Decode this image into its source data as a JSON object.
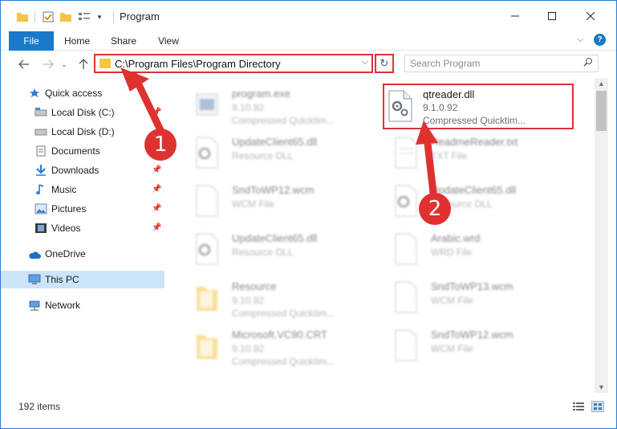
{
  "window": {
    "title": "Program"
  },
  "ribbon": {
    "tabs": [
      "File",
      "Home",
      "Share",
      "View"
    ]
  },
  "address": {
    "path": "C:\\Program Files\\Program Directory"
  },
  "search": {
    "placeholder": "Search Program"
  },
  "sidebar": {
    "items": [
      {
        "label": "Quick access",
        "icon": "star-icon",
        "pinned": false
      },
      {
        "label": "Local Disk (C:)",
        "icon": "drive-icon",
        "pinned": true
      },
      {
        "label": "Local Disk (D:)",
        "icon": "drive-icon",
        "pinned": false
      },
      {
        "label": "Documents",
        "icon": "documents-icon",
        "pinned": true
      },
      {
        "label": "Downloads",
        "icon": "download-icon",
        "pinned": true
      },
      {
        "label": "Music",
        "icon": "music-icon",
        "pinned": true
      },
      {
        "label": "Pictures",
        "icon": "pictures-icon",
        "pinned": true
      },
      {
        "label": "Videos",
        "icon": "videos-icon",
        "pinned": true
      },
      {
        "label": "OneDrive",
        "icon": "cloud-icon",
        "pinned": false
      },
      {
        "label": "This PC",
        "icon": "computer-icon",
        "pinned": false,
        "selected": true
      },
      {
        "label": "Network",
        "icon": "network-icon",
        "pinned": false
      }
    ]
  },
  "files": [
    {
      "name": "program.exe",
      "line2": "9.10.92",
      "line3": "Compressed Quicktim...",
      "icon": "exe-icon"
    },
    {
      "name": "qtreader.dll",
      "line2": "9.1.0.92",
      "line3": "Compressed Quicktim...",
      "icon": "dll-gear-icon",
      "highlighted": true
    },
    {
      "name": "UpdateClient65.dll",
      "line2": "Resource DLL",
      "line3": "",
      "icon": "dll-gear-icon"
    },
    {
      "name": "ReadmeReader.txt",
      "line2": "TXT File",
      "line3": "",
      "icon": "text-file-icon"
    },
    {
      "name": "SndToWP12.wcm",
      "line2": "WCM File",
      "line3": "",
      "icon": "blank-file-icon"
    },
    {
      "name": "UpdateClient65.dll",
      "line2": "Resource DLL",
      "line3": "",
      "icon": "dll-gear-icon"
    },
    {
      "name": "UpdateClient65.dll",
      "line2": "Resource DLL",
      "line3": "",
      "icon": "dll-gear-icon"
    },
    {
      "name": "Arabic.wrd",
      "line2": "WRD File",
      "line3": "",
      "icon": "blank-file-icon"
    },
    {
      "name": "Resource",
      "line2": "9.10.92",
      "line3": "Compressed Quicktim...",
      "icon": "folder-icon"
    },
    {
      "name": "SndToWP13.wcm",
      "line2": "WCM File",
      "line3": "",
      "icon": "blank-file-icon"
    },
    {
      "name": "Microsoft.VC90.CRT",
      "line2": "9.10.92",
      "line3": "Compressed Quicktim...",
      "icon": "folder-icon"
    },
    {
      "name": "SndToWP12.wcm",
      "line2": "WCM File",
      "line3": "",
      "icon": "blank-file-icon"
    }
  ],
  "status": {
    "items_count": "192 items"
  },
  "annotations": {
    "callout1": "1",
    "callout2": "2",
    "color": "#e03131"
  },
  "colors": {
    "accent": "#1979ca",
    "selection": "#cce4f7",
    "folder": "#f5c542"
  }
}
